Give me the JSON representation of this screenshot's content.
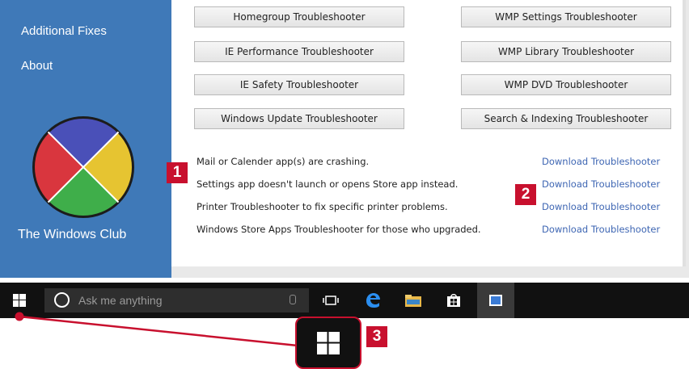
{
  "sidebar": {
    "items": [
      {
        "label": "Additional Fixes"
      },
      {
        "label": "About"
      }
    ],
    "brand": "The Windows Club"
  },
  "troubleshooters": {
    "left": [
      {
        "label": "Homegroup Troubleshooter"
      },
      {
        "label": "IE Performance Troubleshooter"
      },
      {
        "label": "IE Safety Troubleshooter"
      },
      {
        "label": "Windows Update Troubleshooter"
      }
    ],
    "right": [
      {
        "label": "WMP Settings Troubleshooter"
      },
      {
        "label": "WMP Library Troubleshooter"
      },
      {
        "label": "WMP DVD Troubleshooter"
      },
      {
        "label": "Search & Indexing Troubleshooter"
      }
    ]
  },
  "downloads": [
    {
      "description": "Mail or Calender app(s) are crashing.",
      "link": "Download Troubleshooter"
    },
    {
      "description": "Settings app doesn't launch or opens Store app instead.",
      "link": "Download Troubleshooter"
    },
    {
      "description": "Printer Troubleshooter to fix specific printer problems.",
      "link": "Download Troubleshooter"
    },
    {
      "description": "Windows Store Apps Troubleshooter for those who upgraded.",
      "link": "Download Troubleshooter"
    }
  ],
  "taskbar": {
    "search_placeholder": "Ask me anything"
  },
  "callouts": [
    "1",
    "2",
    "3"
  ],
  "colors": {
    "sidebar_bg": "#3f79b8",
    "callout_red": "#c8102e",
    "link_blue": "#3e66b3",
    "taskbar_bg": "#111111"
  }
}
